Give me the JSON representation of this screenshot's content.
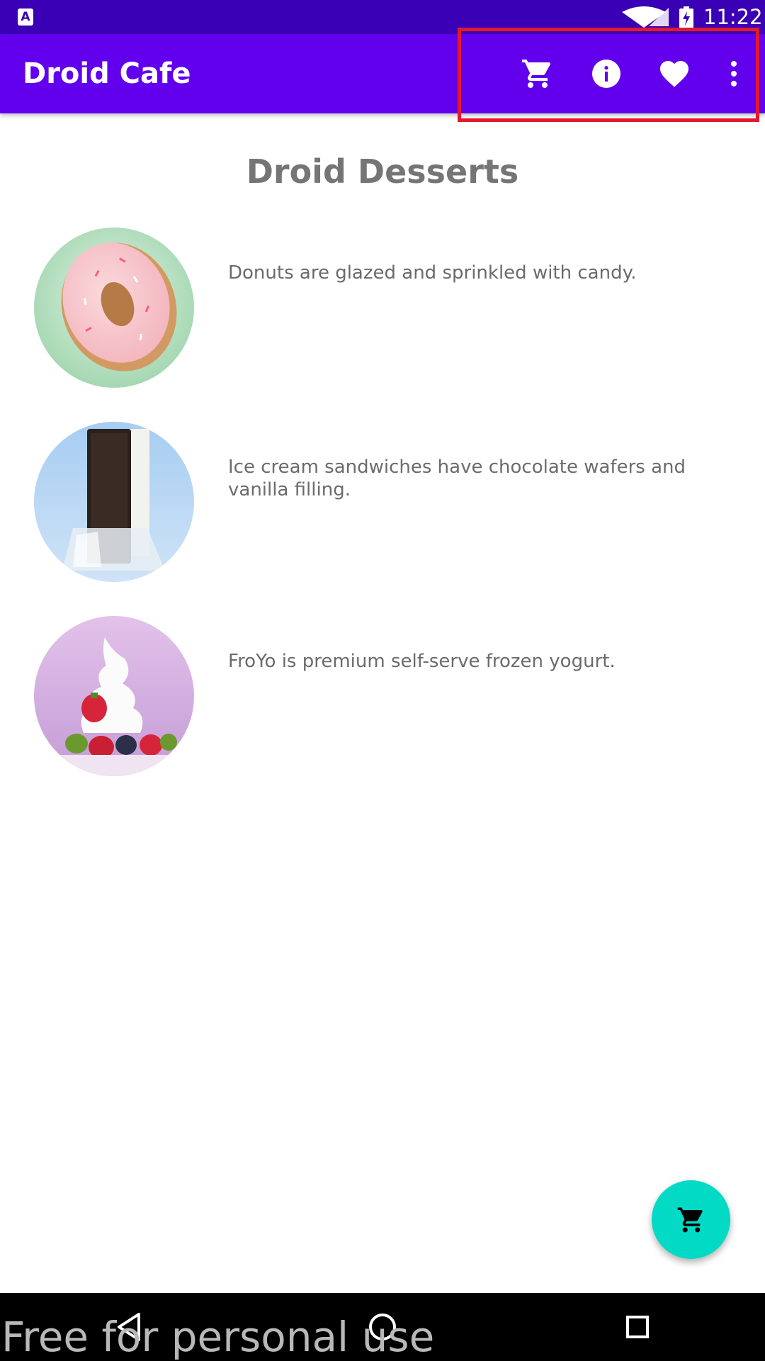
{
  "status_bar": {
    "time": "11:22",
    "notification_icon": "android-keyboard-icon",
    "notification_letter": "A"
  },
  "app_bar": {
    "title": "Droid Cafe",
    "actions": [
      "cart-icon",
      "info-icon",
      "favorite-icon",
      "overflow-menu-icon"
    ],
    "background": "#6200ee"
  },
  "content": {
    "title": "Droid Desserts",
    "items": [
      {
        "image": "donut-image",
        "description": "Donuts are glazed and sprinkled with candy."
      },
      {
        "image": "ice-cream-sandwich-image",
        "description": "Ice cream sandwiches have chocolate wafers and vanilla filling."
      },
      {
        "image": "froyo-image",
        "description": "FroYo is premium self-serve frozen yogurt."
      }
    ]
  },
  "fab": {
    "icon": "cart-icon",
    "color": "#03dac5"
  },
  "nav_bar": {
    "buttons": [
      "back-icon",
      "home-icon",
      "recents-icon"
    ]
  },
  "watermark": "Free for personal use",
  "colors": {
    "status_bar": "#3a00b6",
    "highlight": "#e5172e"
  }
}
